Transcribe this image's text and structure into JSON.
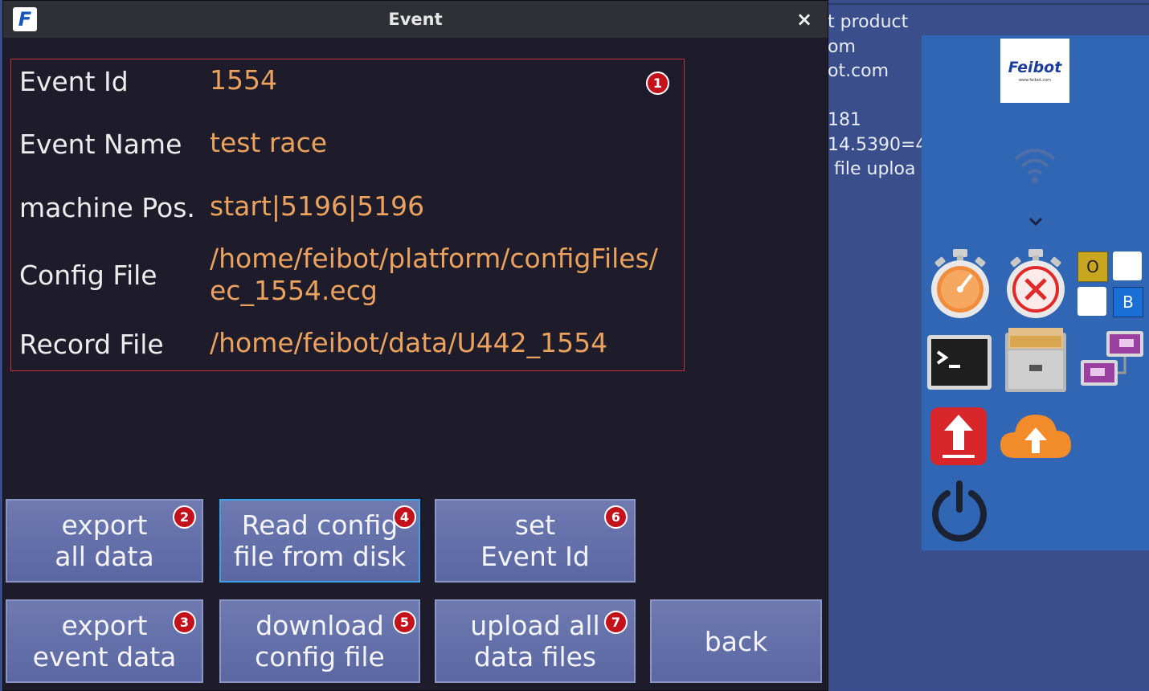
{
  "window": {
    "title": "Event",
    "app_icon_letter": "F",
    "close_glyph": "×"
  },
  "event": {
    "fields": [
      {
        "label": "Event Id",
        "value": "1554"
      },
      {
        "label": "Event Name",
        "value": "test race"
      },
      {
        "label": "machine Pos.",
        "value": "start|5196|5196"
      },
      {
        "label": "Config File",
        "value_line1": "/home/feibot/platform/configFiles/",
        "value_line2": "ec_1554.ecg"
      },
      {
        "label": "Record File",
        "value": "/home/feibot/data/U442_1554"
      }
    ]
  },
  "badges": [
    "1",
    "2",
    "3",
    "4",
    "5",
    "6",
    "7"
  ],
  "buttons": {
    "export_all": {
      "line1": "export",
      "line2": "all data"
    },
    "export_event": {
      "line1": "export",
      "line2": "event data"
    },
    "read_config": {
      "line1": "Read config",
      "line2": "file from disk"
    },
    "download_config": {
      "line1": "download",
      "line2": "config file"
    },
    "set_event_id": {
      "line1": "set",
      "line2": "Event Id"
    },
    "upload_all": {
      "line1": "upload all",
      "line2": "data files"
    },
    "back": "back"
  },
  "background_text": {
    "line1": "t product",
    "line2": "om",
    "line3": "ot.com",
    "line4": "181",
    "line5": "14.5390=4",
    "line6": "file uploa"
  },
  "launcher": {
    "logo_brand": "Feibot",
    "logo_url": "www.feibot.com",
    "tile_o": "O",
    "tile_b": "B",
    "icons": [
      "wifi-icon",
      "chevron-down-icon",
      "stopwatch-icon",
      "stopwatch-cancel-icon",
      "ob-tiles-icon",
      "terminal-icon",
      "file-cabinet-icon",
      "network-icon",
      "upload-icon",
      "cloud-upload-icon",
      "power-icon"
    ]
  },
  "colors": {
    "window_bg": "#1e1c2b",
    "value_text": "#eaa25e",
    "badge": "#c4121c",
    "button": "#6470a8",
    "launcher": "#3166b4"
  }
}
